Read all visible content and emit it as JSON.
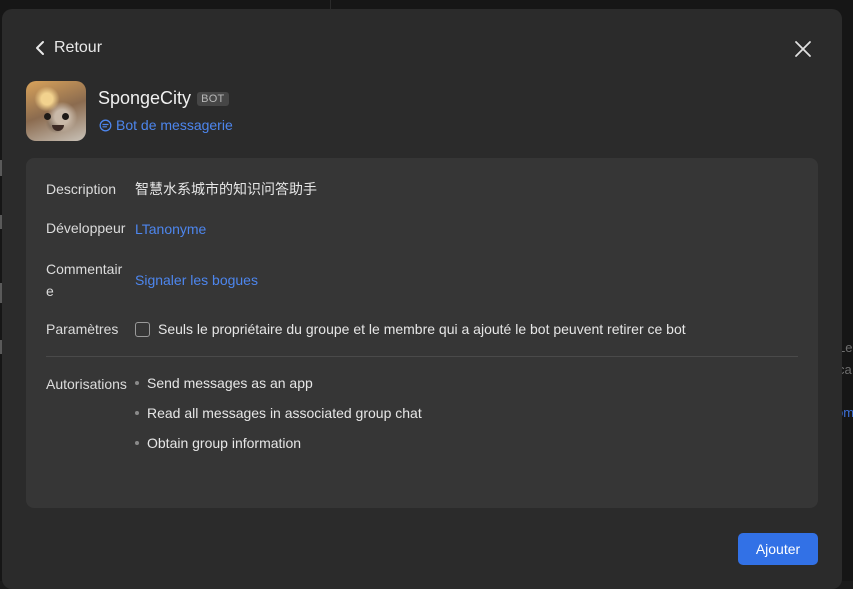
{
  "background": {
    "text1": "Le",
    "text2": "ca",
    "text3": "om"
  },
  "header": {
    "back_label": "Retour",
    "back_icon": "chevron-left-icon",
    "close_icon": "close-icon"
  },
  "bot": {
    "name": "SpongeCity",
    "badge": "BOT",
    "type_label": "Bot de messagerie",
    "type_icon": "chat-bubble-icon"
  },
  "details": {
    "description_label": "Description",
    "description_value": "智慧水系城市的知识问答助手",
    "developer_label": "Développeur",
    "developer_value": "LTanonyme",
    "comment_label": "Commentaire",
    "comment_value": "Signaler les bogues",
    "settings_label": "Paramètres",
    "settings_checkbox_label": "Seuls le propriétaire du groupe et le membre qui a ajouté le bot peuvent retirer ce bot",
    "settings_checked": false,
    "permissions_label": "Autorisations",
    "permissions": [
      "Send messages as an app",
      "Read all messages in associated group chat",
      "Obtain group information"
    ]
  },
  "footer": {
    "add_label": "Ajouter"
  },
  "colors": {
    "accent": "#3271e6",
    "link": "#4d86ee",
    "modal_bg": "#2b2b2b",
    "card_bg": "#363636"
  }
}
